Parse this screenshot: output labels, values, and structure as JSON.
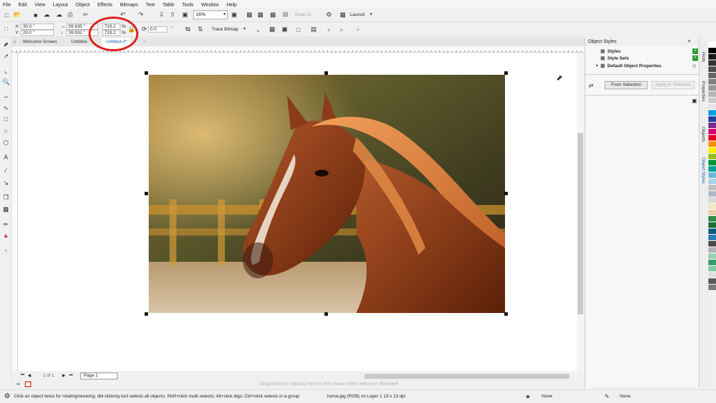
{
  "menu": [
    "File",
    "Edit",
    "View",
    "Layout",
    "Object",
    "Effects",
    "Bitmaps",
    "Text",
    "Table",
    "Tools",
    "Window",
    "Help"
  ],
  "standard_toolbar": {
    "zoom": "16%",
    "snap_to": "Snap To",
    "launch": "Launch"
  },
  "property_bar": {
    "x_label": "X:",
    "x": "30.0 \"",
    "y_label": "Y:",
    "y": "20.0 \"",
    "width": "59.935 \"",
    "height": "39.932 \"",
    "scale_x": "719.2",
    "scale_y": "719.2",
    "pct": "%",
    "rotation": "0.0",
    "degree": "°",
    "trace_bitmap": "Trace Bitmap"
  },
  "tabs": [
    {
      "label": "Welcome Screen"
    },
    {
      "label": "Untitled-"
    },
    {
      "label": "Untitled-2*"
    }
  ],
  "page_nav": {
    "of": "1 of 1",
    "page_label": "Page 1"
  },
  "color_tray_hint": "Drag colors (or objects) here to store these colors with your document",
  "status": {
    "hint": "Click an object twice for rotating/skewing; dbl-clicking tool selects all objects; Shift+click multi-selects; Alt+click digs; Ctrl+click selects in a group",
    "object_info": "horse.jpg (RGB) on Layer 1 13 x 13 dpi",
    "fill": "None",
    "outline": "None"
  },
  "docker": {
    "title": "Object Styles",
    "tree": [
      "Styles",
      "Style Sets",
      "Default Object Properties"
    ],
    "from_selection": "From Selection",
    "apply_to_selection": "Apply to Selection"
  },
  "side_tabs": [
    "Hints",
    "Properties",
    "Objects",
    "Object Styles"
  ],
  "palette": [
    "#ffffff",
    "#000000",
    "#1a1a1a",
    "#333333",
    "#4d4d4d",
    "#666666",
    "#808080",
    "#999999",
    "#b3b3b3",
    "#cccccc",
    "#e6e6e6",
    "#00a1e0",
    "#1e3f9b",
    "#7b2a8e",
    "#d6006e",
    "#e3001b",
    "#f39200",
    "#ffed00",
    "#95c11f",
    "#00963f",
    "#00a19a",
    "#6fb7d6",
    "#a8d3ea",
    "#c0c0c0",
    "#b0b8c8",
    "#d8d8d8",
    "#f0e6c8",
    "#e8d0a8",
    "#2d8a4a",
    "#1c6e3a",
    "#0f5c7a",
    "#2a7fb8",
    "#4b4b4b",
    "#b5b5b5",
    "#9bcfb3",
    "#3a9a6a",
    "#88c8a0",
    "#e0e0e0",
    "#5a5a5a",
    "#7a7a7a"
  ]
}
